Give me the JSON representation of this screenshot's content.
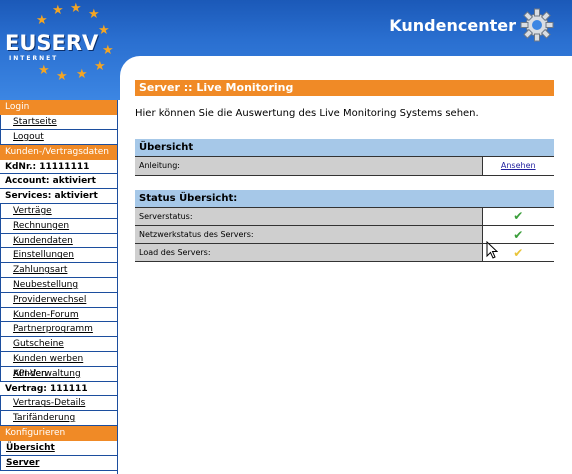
{
  "header": {
    "logo_text": "EUSERV",
    "logo_sub": "INTERNET",
    "title": "Kundencenter"
  },
  "sidebar": {
    "login_head": "Login",
    "login_links": [
      "Startseite",
      "Logout"
    ],
    "kunden_head": "Kunden-/Vertragsdaten",
    "kdnr": "KdNr.: 11111111",
    "account": "Account: aktiviert",
    "services": "Services: aktiviert",
    "service_links": [
      "Verträge",
      "Rechnungen",
      "Kundendaten",
      "Einstellungen",
      "Zahlungsart",
      "Neubestellung",
      "Providerwechsel",
      "Kunden-Forum",
      "Partnerprogramm",
      "Gutscheine",
      "Kunden werben Kunden",
      "API-Verwaltung"
    ],
    "vertrag": "Vertrag: 111111",
    "vertrag_links": [
      "Vertrags-Details",
      "Tarifänderung"
    ],
    "konfig_head": "Konfigurieren",
    "konfig_links": [
      "Übersicht",
      "Server"
    ]
  },
  "main": {
    "title": "Server :: Live Monitoring",
    "intro": "Hier können Sie die Auswertung des Live Monitoring Systems sehen.",
    "overview": {
      "head": "Übersicht",
      "label": "Anleitung:",
      "link": "Ansehen"
    },
    "status": {
      "head": "Status Übersicht:",
      "rows": [
        {
          "label": "Serverstatus:",
          "mark": "✔",
          "color": "#3a9e3a"
        },
        {
          "label": "Netzwerkstatus des Servers:",
          "mark": "✔",
          "color": "#3a9e3a"
        },
        {
          "label": "Load des Servers:",
          "mark": "✔",
          "color": "#e8c43a"
        }
      ]
    }
  }
}
